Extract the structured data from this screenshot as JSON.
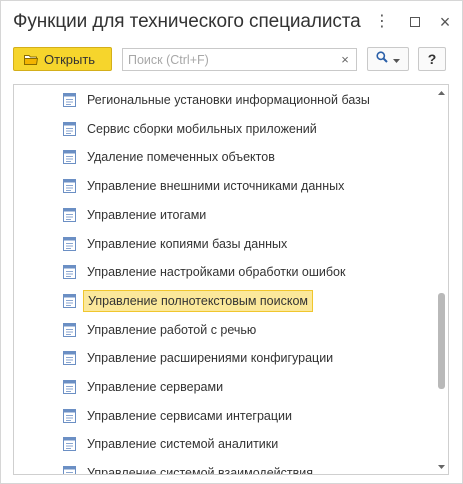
{
  "window": {
    "title": "Функции для технического специалиста"
  },
  "toolbar": {
    "open_label": "Открыть",
    "search_placeholder": "Поиск (Ctrl+F)",
    "search_value": "",
    "clear_label": "×",
    "help_label": "?"
  },
  "list": {
    "items": [
      {
        "label": "Региональные установки информационной базы",
        "selected": false
      },
      {
        "label": "Сервис сборки мобильных приложений",
        "selected": false
      },
      {
        "label": "Удаление помеченных объектов",
        "selected": false
      },
      {
        "label": "Управление внешними источниками данных",
        "selected": false
      },
      {
        "label": "Управление итогами",
        "selected": false
      },
      {
        "label": "Управление копиями базы данных",
        "selected": false
      },
      {
        "label": "Управление настройками обработки ошибок",
        "selected": false
      },
      {
        "label": "Управление полнотекстовым поиском",
        "selected": true
      },
      {
        "label": "Управление работой с речью",
        "selected": false
      },
      {
        "label": "Управление расширениями конфигурации",
        "selected": false
      },
      {
        "label": "Управление серверами",
        "selected": false
      },
      {
        "label": "Управление сервисами интеграции",
        "selected": false
      },
      {
        "label": "Управление системой аналитики",
        "selected": false
      },
      {
        "label": "Управление системой взаимодействия",
        "selected": false
      }
    ]
  },
  "scroll": {
    "position_fraction": 0.73
  },
  "colors": {
    "accent": "#f6d52c",
    "selection_fill": "#fbe89b",
    "selection_border": "#f0c62e"
  }
}
